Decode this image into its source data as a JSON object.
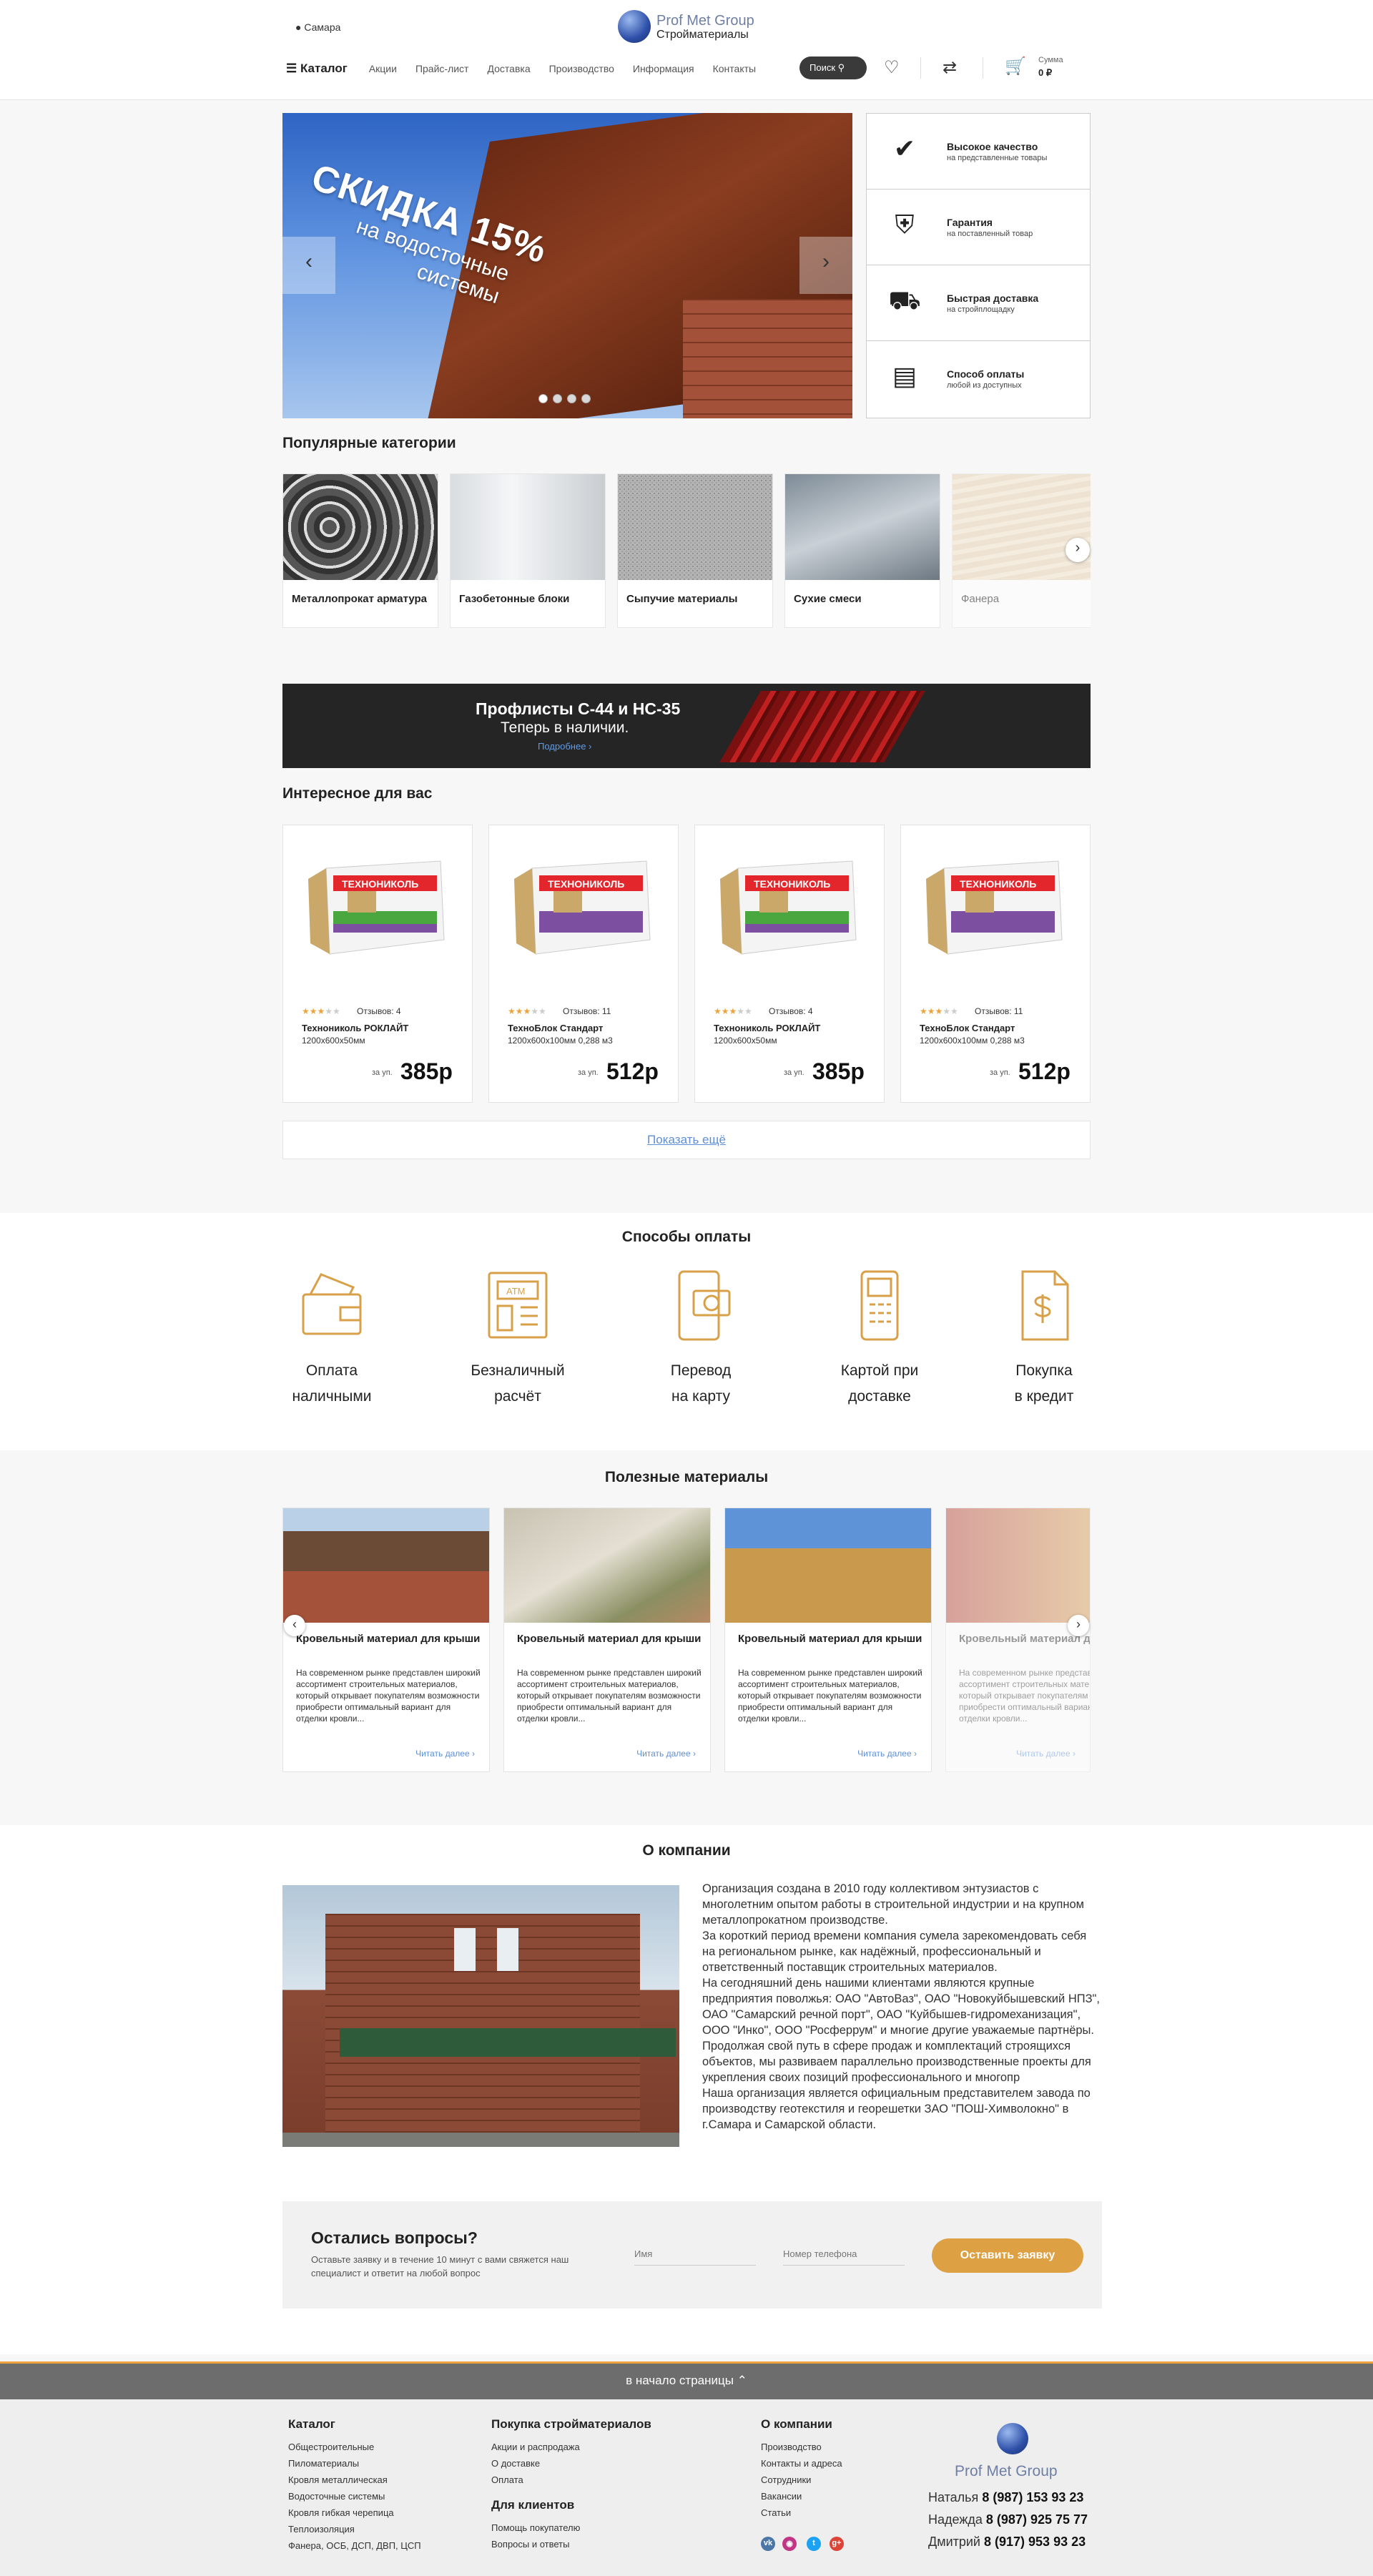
{
  "header": {
    "city": "Самара",
    "logo_name": "Prof Met Group",
    "logo_sub": "Стройматериалы",
    "catalog": "Каталог",
    "nav": [
      "Акции",
      "Прайс-лист",
      "Доставка",
      "Производство",
      "Информация",
      "Контакты"
    ],
    "search": "Поиск",
    "cart_sum_label": "Сумма",
    "cart_sum_value": "0 ₽"
  },
  "hero": {
    "promo_big": "СКИДКА 15%",
    "promo_line1": "на водосточные",
    "promo_line2": "системы",
    "slides": 4,
    "active_slide": 1
  },
  "features": [
    {
      "title": "Высокое качество",
      "sub": "на представленные товары",
      "icon": "quality-check-icon"
    },
    {
      "title": "Гарантия",
      "sub": "на поставленный товар",
      "icon": "shield-check-icon"
    },
    {
      "title": "Быстрая доставка",
      "sub": "на стройплощадку",
      "icon": "truck-icon"
    },
    {
      "title": "Способ оплаты",
      "sub": "любой из доступных",
      "icon": "money-stack-icon"
    }
  ],
  "categories": {
    "title": "Популярные категории",
    "items": [
      {
        "label": "Металлопрокат арматура"
      },
      {
        "label": "Газобетонные блоки"
      },
      {
        "label": "Сыпучие материалы"
      },
      {
        "label": "Сухие смеси"
      },
      {
        "label": "Фанера"
      }
    ]
  },
  "banner": {
    "line1": "Профлисты С-44 и НС-35",
    "line2": "Теперь в наличии.",
    "link": "Подробнее ›"
  },
  "products": {
    "title": "Интересное для вас",
    "items": [
      {
        "rating": 3,
        "reviews": "Отзывов: 4",
        "name": "Технониколь РОКЛАЙТ",
        "dims": "1200х600х50мм",
        "unit": "за уп.",
        "price": "385р"
      },
      {
        "rating": 3,
        "reviews": "Отзывов: 11",
        "name": "ТехноБлок Стандарт",
        "dims": "1200х600х100мм 0,288 м3",
        "unit": "за уп.",
        "price": "512р"
      },
      {
        "rating": 3,
        "reviews": "Отзывов: 4",
        "name": "Технониколь РОКЛАЙТ",
        "dims": "1200х600х50мм",
        "unit": "за уп.",
        "price": "385р"
      },
      {
        "rating": 3,
        "reviews": "Отзывов: 11",
        "name": "ТехноБлок Стандарт",
        "dims": "1200х600х100мм 0,288 м3",
        "unit": "за уп.",
        "price": "512р"
      }
    ],
    "pack_brand": "ТЕХНОНИКОЛЬ",
    "show_more": "Показать ещё"
  },
  "payment": {
    "title": "Способы оплаты",
    "items": [
      {
        "l1": "Оплата",
        "l2": "наличными"
      },
      {
        "l1": "Безналичный",
        "l2": "расчёт"
      },
      {
        "l1": "Перевод",
        "l2": "на карту"
      },
      {
        "l1": "Картой при",
        "l2": "доставке"
      },
      {
        "l1": "Покупка",
        "l2": "в кредит"
      }
    ],
    "accent": "#d9a04a"
  },
  "materials": {
    "title": "Полезные материалы",
    "items": [
      {
        "title": "Кровельный материал для крыши",
        "text": "На современном рынке представлен широкий ассортимент строительных материалов, который открывает покупателям возможности приобрести оптимальный вариант для отделки кровли...",
        "read": "Читать далее ›"
      },
      {
        "title": "Кровельный материал для крыши",
        "text": "На современном рынке представлен широкий ассортимент строительных материалов, который открывает покупателям возможности приобрести оптимальный вариант для отделки кровли...",
        "read": "Читать далее ›"
      },
      {
        "title": "Кровельный материал для крыши",
        "text": "На современном рынке представлен широкий ассортимент строительных материалов, который открывает покупателям возможности приобрести оптимальный вариант для отделки кровли...",
        "read": "Читать далее ›"
      },
      {
        "title": "Кровельный материал для крыши",
        "text": "На современном рынке представлен широкий ассортимент строительных материалов, который открывает покупателям возможности приобрести оптимальный вариант для отделки кровли...",
        "read": "Читать далее ›"
      }
    ]
  },
  "about": {
    "title": "О компании",
    "text": "Организация создана в 2010 году коллективом энтузиастов с многолетним опытом работы в строительной индустрии и на крупном металлопрокатном производстве.\nЗа короткий период времени компания сумела зарекомендовать себя на региональном рынке, как надёжный, профессиональный и ответственный поставщик строительных материалов.\nНа сегодняшний день нашими клиентами являются крупные предприятия поволжья: ОАО \"АвтоВаз\", ОАО \"Новокуйбышевский НПЗ\", ОАО \"Самарский речной порт\", ОАО \"Куйбышев-гидромеханизация\", ООО \"Инко\", ООО \"Росферрум\" и многие другие уважаемые партнёры.\nПродолжая свой путь в сфере продаж и комплектаций строящихся объектов, мы развиваем параллельно производственные проекты для укрепления своих позиций профессионального и многопр\nНаша организация является официальным представителем завода по производству геотекстиля и георешетки ЗАО \"ПОШ-Химволокно\" в г.Самара и Самарской области."
  },
  "contact": {
    "title": "Остались вопросы?",
    "text": "Оставьте заявку и в течение 10 минут с вами свяжется наш специалист и ответит на любой вопрос",
    "name_placeholder": "Имя",
    "phone_placeholder": "Номер телефона",
    "button": "Оставить заявку"
  },
  "footer": {
    "to_top": "в начало страницы",
    "col1": {
      "title": "Каталог",
      "items": [
        "Общестроительные",
        "Пиломатериалы",
        "Кровля металлическая",
        "Водосточные системы",
        "Кровля гибкая черепица",
        "Теплоизоляция",
        "Фанера, ОСБ, ДСП, ДВП, ЦСП"
      ]
    },
    "col2": {
      "title": "Покупка стройматериалов",
      "items": [
        "Акции и распродажа",
        "О доставке",
        "Оплата"
      ]
    },
    "col2b": {
      "title": "Для клиентов",
      "items": [
        "Помощь покупателю",
        "Вопросы и ответы"
      ]
    },
    "col3": {
      "title": "О компании",
      "items": [
        "Производство",
        "Контакты и адреса",
        "Сотрудники",
        "Вакансии",
        "Статьи"
      ]
    },
    "brand": "Prof Met Group",
    "phones": [
      {
        "name": "Наталья",
        "num": "8 (987) 153 93 23"
      },
      {
        "name": "Надежда",
        "num": "8 (987) 925 75 77"
      },
      {
        "name": "Дмитрий",
        "num": "8 (917) 953 93 23"
      }
    ],
    "social": [
      "vk-icon",
      "instagram-icon",
      "twitter-icon",
      "google-plus-icon"
    ]
  }
}
